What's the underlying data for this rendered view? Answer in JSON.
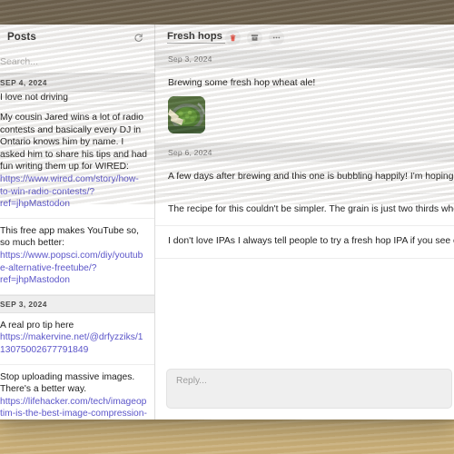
{
  "sidebar": {
    "title": "Posts",
    "refresh_icon": "refresh-icon",
    "search": {
      "placeholder": "Search...",
      "value": ""
    },
    "groups": [
      {
        "date": "SEP 4, 2024",
        "posts": [
          {
            "text": "I love not driving",
            "clipped": true
          },
          {
            "text": "My cousin Jared wins a lot of radio contests and basically every DJ in Ontario knows him by name. I asked him to share his tips and had fun writing them up for WIRED: ",
            "link": "https://www.wired.com/story/how-to-win-radio-contests/?ref=jhpMastodon"
          },
          {
            "text": "This free app makes YouTube so, so much better: ",
            "link": "https://www.popsci.com/diy/youtube-alternative-freetube/?ref=jhpMastodon"
          }
        ]
      },
      {
        "date": "SEP 3, 2024",
        "posts": [
          {
            "text": "A real pro tip here ",
            "link": "https://makervine.net/@drfyzziks/113075002677791849"
          },
          {
            "text": "Stop uploading massive images. There's a better way. ",
            "link": "https://lifehacker.com/tech/imageoptim-is-the-best-image-compression-app-for-mac?ref=jhpMastodon"
          }
        ]
      }
    ]
  },
  "main": {
    "thread_title": "Fresh hops",
    "actions": [
      {
        "name": "delete-button",
        "icon": "trash-icon",
        "color": "#e8564a"
      },
      {
        "name": "archive-button",
        "icon": "archive-icon",
        "color": "#8a8a8a"
      },
      {
        "name": "more-button",
        "icon": "more-icon",
        "color": "#8a8a8a"
      }
    ],
    "messages": [
      {
        "date": "Sep 3, 2024",
        "body": "Brewing some fresh hop wheat ale!",
        "attachment": "hops-brew-photo"
      },
      {
        "date": "Sep 6, 2024",
        "body": "A few days after brewing and this one is bubbling happily! I'm hoping to cold crash it later this week. I'm leaving on a trip for a month right after, which is a little sad, but it will be ready to drink when I get home which is great."
      },
      {
        "body": "The recipe for this couldn't be simpler. The grain is just two thirds wheat malt and one third two row barely malt. I used an ounce of bittering hops and US-05 yeast, then added a big handful of freshly picked nugget hops in the flameout. I'm hoping it will be less an IPA and more of a citrusy wheat beer."
      },
      {
        "body": "I don't love IPAs I always tell people to try a fresh hop IPA if you see on on a tap list. Hops, like most beer, are dried before they're used in brewing. Fresh hop beer is exactly what it sounds like: beer made with hops that have never been dry. This results in less bitterness and a lot more fresh flavor coming through. The catch: you can only make them during harvest season."
      }
    ],
    "reply": {
      "placeholder": "Reply..."
    }
  }
}
